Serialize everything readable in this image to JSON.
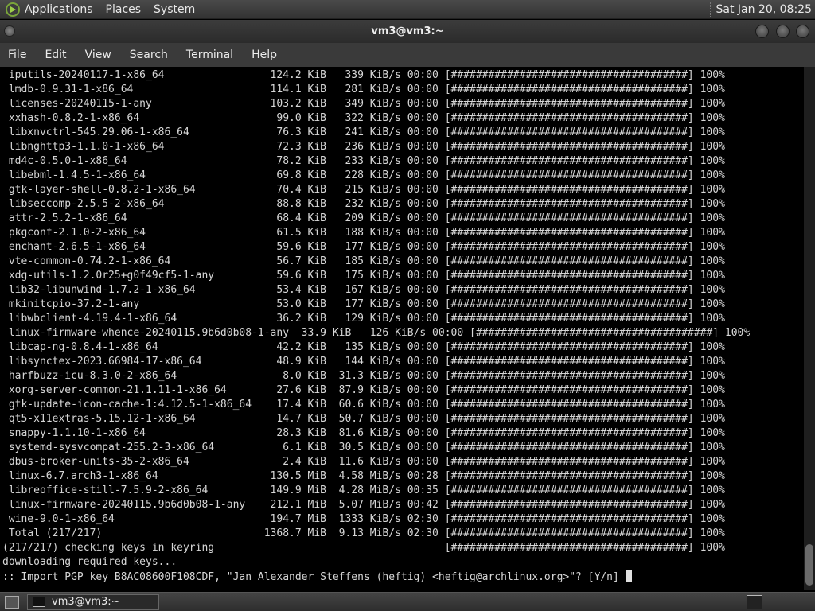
{
  "top_panel": {
    "menus": [
      "Applications",
      "Places",
      "System"
    ],
    "clock": "Sat Jan 20, 08:25"
  },
  "window": {
    "title": "vm3@vm3:~"
  },
  "menubar": {
    "items": [
      "File",
      "Edit",
      "View",
      "Search",
      "Terminal",
      "Help"
    ]
  },
  "terminal": {
    "lines": [
      " iputils-20240117-1-x86_64                 124.2 KiB   339 KiB/s 00:00 [######################################] 100%",
      " lmdb-0.9.31-1-x86_64                      114.1 KiB   281 KiB/s 00:00 [######################################] 100%",
      " licenses-20240115-1-any                   103.2 KiB   349 KiB/s 00:00 [######################################] 100%",
      " xxhash-0.8.2-1-x86_64                      99.0 KiB   322 KiB/s 00:00 [######################################] 100%",
      " libxnvctrl-545.29.06-1-x86_64              76.3 KiB   241 KiB/s 00:00 [######################################] 100%",
      " libnghttp3-1.1.0-1-x86_64                  72.3 KiB   236 KiB/s 00:00 [######################################] 100%",
      " md4c-0.5.0-1-x86_64                        78.2 KiB   233 KiB/s 00:00 [######################################] 100%",
      " libebml-1.4.5-1-x86_64                     69.8 KiB   228 KiB/s 00:00 [######################################] 100%",
      " gtk-layer-shell-0.8.2-1-x86_64             70.4 KiB   215 KiB/s 00:00 [######################################] 100%",
      " libseccomp-2.5.5-2-x86_64                  88.8 KiB   232 KiB/s 00:00 [######################################] 100%",
      " attr-2.5.2-1-x86_64                        68.4 KiB   209 KiB/s 00:00 [######################################] 100%",
      " pkgconf-2.1.0-2-x86_64                     61.5 KiB   188 KiB/s 00:00 [######################################] 100%",
      " enchant-2.6.5-1-x86_64                     59.6 KiB   177 KiB/s 00:00 [######################################] 100%",
      " vte-common-0.74.2-1-x86_64                 56.7 KiB   185 KiB/s 00:00 [######################################] 100%",
      " xdg-utils-1.2.0r25+g0f49cf5-1-any          59.6 KiB   175 KiB/s 00:00 [######################################] 100%",
      " lib32-libunwind-1.7.2-1-x86_64             53.4 KiB   167 KiB/s 00:00 [######################################] 100%",
      " mkinitcpio-37.2-1-any                      53.0 KiB   177 KiB/s 00:00 [######################################] 100%",
      " libwbclient-4.19.4-1-x86_64                36.2 KiB   129 KiB/s 00:00 [######################################] 100%",
      " linux-firmware-whence-20240115.9b6d0b08-1-any  33.9 KiB   126 KiB/s 00:00 [######################################] 100%",
      " libcap-ng-0.8.4-1-x86_64                   42.2 KiB   135 KiB/s 00:00 [######################################] 100%",
      " libsynctex-2023.66984-17-x86_64            48.9 KiB   144 KiB/s 00:00 [######################################] 100%",
      " harfbuzz-icu-8.3.0-2-x86_64                 8.0 KiB  31.3 KiB/s 00:00 [######################################] 100%",
      " xorg-server-common-21.1.11-1-x86_64        27.6 KiB  87.9 KiB/s 00:00 [######################################] 100%",
      " gtk-update-icon-cache-1:4.12.5-1-x86_64    17.4 KiB  60.6 KiB/s 00:00 [######################################] 100%",
      " qt5-x11extras-5.15.12-1-x86_64             14.7 KiB  50.7 KiB/s 00:00 [######################################] 100%",
      " snappy-1.1.10-1-x86_64                     28.3 KiB  81.6 KiB/s 00:00 [######################################] 100%",
      " systemd-sysvcompat-255.2-3-x86_64           6.1 KiB  30.5 KiB/s 00:00 [######################################] 100%",
      " dbus-broker-units-35-2-x86_64               2.4 KiB  11.6 KiB/s 00:00 [######################################] 100%",
      " linux-6.7.arch3-1-x86_64                  130.5 MiB  4.58 MiB/s 00:28 [######################################] 100%",
      " libreoffice-still-7.5.9-2-x86_64          149.9 MiB  4.28 MiB/s 00:35 [######################################] 100%",
      " linux-firmware-20240115.9b6d0b08-1-any    212.1 MiB  5.07 MiB/s 00:42 [######################################] 100%",
      " wine-9.0-1-x86_64                         194.7 MiB  1333 KiB/s 02:30 [######################################] 100%",
      " Total (217/217)                          1368.7 MiB  9.13 MiB/s 02:30 [######################################] 100%",
      "(217/217) checking keys in keyring                                     [######################################] 100%",
      "downloading required keys...",
      ":: Import PGP key B8AC08600F108CDF, \"Jan Alexander Steffens (heftig) <heftig@archlinux.org>\"? [Y/n] "
    ]
  },
  "taskbar": {
    "task_label": "vm3@vm3:~"
  }
}
